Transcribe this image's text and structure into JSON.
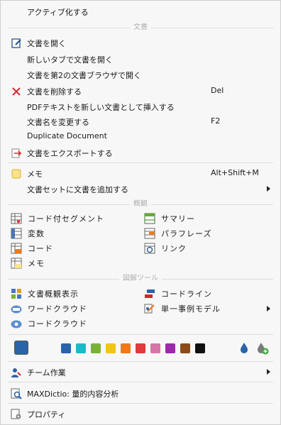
{
  "menu": {
    "activate": "アクティブ化する",
    "section_document": "文書",
    "open_document": "文書を開く",
    "open_in_new_tab": "新しいタブで文書を開く",
    "open_in_second_browser": "文書を第2の文書ブラウザで開く",
    "delete_document": "文書を削除する",
    "delete_shortcut": "Del",
    "insert_pdf_text": "PDFテキストを新しい文書として挿入する",
    "rename_document": "文書名を変更する",
    "rename_shortcut": "F2",
    "duplicate_document": "Duplicate Document",
    "export_document": "文書をエクスポートする",
    "memo": "メモ",
    "memo_shortcut": "Alt+Shift+M",
    "add_to_document_set": "文書セットに文書を追加する",
    "section_overview": "概観",
    "coded_segments": "コード付セグメント",
    "summary": "サマリー",
    "variables": "変数",
    "paraphrase": "パラフレーズ",
    "codes": "コード",
    "links": "リンク",
    "memos": "メモ",
    "section_visual_tools": "図解ツール",
    "document_overview": "文書概観表示",
    "codeline": "コードライン",
    "word_cloud": "ワードクラウド",
    "single_case_model": "単一事例モデル",
    "code_cloud": "コードクラウド",
    "team_work": "チーム作業",
    "maxdictio": "MAXDictio: 量的内容分析",
    "properties": "プロパティ"
  },
  "colors": {
    "current": "#2a64a8",
    "swatches": [
      "#2a64a8",
      "#1fb8c8",
      "#7ab332",
      "#f0c419",
      "#ee7a1a",
      "#e0393e",
      "#d675a8",
      "#9a2aa6",
      "#8a4a1a",
      "#111111"
    ]
  }
}
